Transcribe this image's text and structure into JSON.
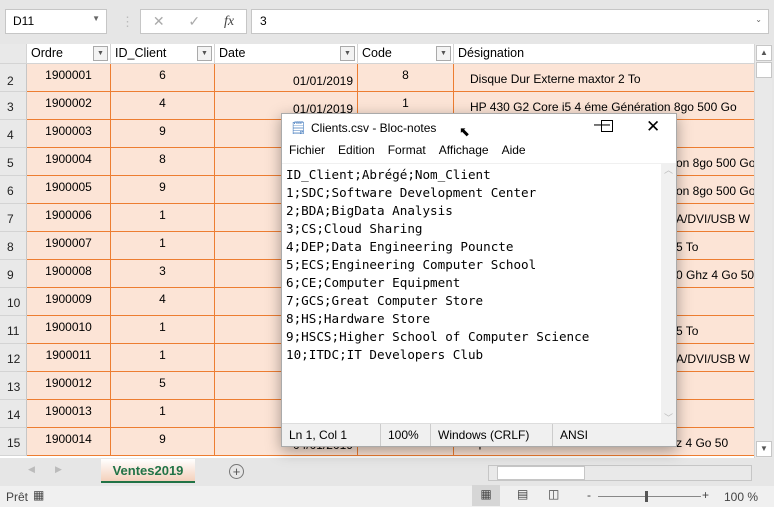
{
  "formula_bar": {
    "name_box": "D11",
    "cancel_icon": "✕",
    "enter_icon": "✓",
    "fx_label": "fx",
    "value": "3"
  },
  "columns": [
    "Ordre",
    "ID_Client",
    "Date",
    "Code",
    "Désignation"
  ],
  "rows": [
    {
      "n": "2",
      "ordre": "1900001",
      "id": "6",
      "date": "01/01/2019",
      "code": "8",
      "des": "Disque Dur Externe maxtor 2 To"
    },
    {
      "n": "3",
      "ordre": "1900002",
      "id": "4",
      "date": "01/01/2019",
      "code": "1",
      "des": "HP 430 G2 Core i5 4 éme Génération 8go 500 Go"
    },
    {
      "n": "4",
      "ordre": "1900003",
      "id": "9",
      "date": "",
      "code": "",
      "des": ""
    },
    {
      "n": "5",
      "ordre": "1900004",
      "id": "8",
      "date": "",
      "code": "",
      "des": "on 8go 500 Go"
    },
    {
      "n": "6",
      "ordre": "1900005",
      "id": "9",
      "date": "",
      "code": "",
      "des": "on 8go 500 Go"
    },
    {
      "n": "7",
      "ordre": "1900006",
      "id": "1",
      "date": "",
      "code": "",
      "des": "A/DVI/USB W"
    },
    {
      "n": "8",
      "ordre": "1900007",
      "id": "1",
      "date": "",
      "code": "",
      "des": "5 To"
    },
    {
      "n": "9",
      "ordre": "1900008",
      "id": "3",
      "date": "",
      "code": "",
      "des": "0 Ghz 4 Go 50"
    },
    {
      "n": "10",
      "ordre": "1900009",
      "id": "4",
      "date": "",
      "code": "",
      "des": ""
    },
    {
      "n": "11",
      "ordre": "1900010",
      "id": "1",
      "date": "",
      "code": "",
      "des": "5 To"
    },
    {
      "n": "12",
      "ordre": "1900011",
      "id": "1",
      "date": "",
      "code": "",
      "des": "A/DVI/USB W"
    },
    {
      "n": "13",
      "ordre": "1900012",
      "id": "5",
      "date": "",
      "code": "",
      "des": ""
    },
    {
      "n": "14",
      "ordre": "1900013",
      "id": "1",
      "date": "",
      "code": "",
      "des": ""
    },
    {
      "n": "15",
      "ordre": "1900014",
      "id": "9",
      "date": "04/01/2019",
      "code": "",
      "des": "Hp Core i7 4 éme Générattion 3.40 Ghz 4 Go 50"
    }
  ],
  "sheet_tab": "Ventes2019",
  "status": {
    "ready": "Prêt",
    "zoom": "100 %"
  },
  "notepad": {
    "title": "Clients.csv - Bloc-notes",
    "menu": [
      "Fichier",
      "Edition",
      "Format",
      "Affichage",
      "Aide"
    ],
    "content": "ID_Client;Abrégé;Nom_Client\n1;SDC;Software Development Center\n2;BDA;BigData Analysis\n3;CS;Cloud Sharing\n4;DEP;Data Engineering Pouncte\n5;ECS;Engineering Computer School\n6;CE;Computer Equipment\n7;GCS;Great Computer Store\n8;HS;Hardware Store\n9;HSCS;Higher School of Computer Science\n10;ITDC;IT Developers Club",
    "status": {
      "position": "Ln 1, Col 1",
      "zoom": "100%",
      "eol": "Windows (CRLF)",
      "encoding": "ANSI"
    }
  },
  "colors": {
    "table_fill": "#fce4d6",
    "table_border": "#ed7d31",
    "excel_green": "#217346"
  }
}
